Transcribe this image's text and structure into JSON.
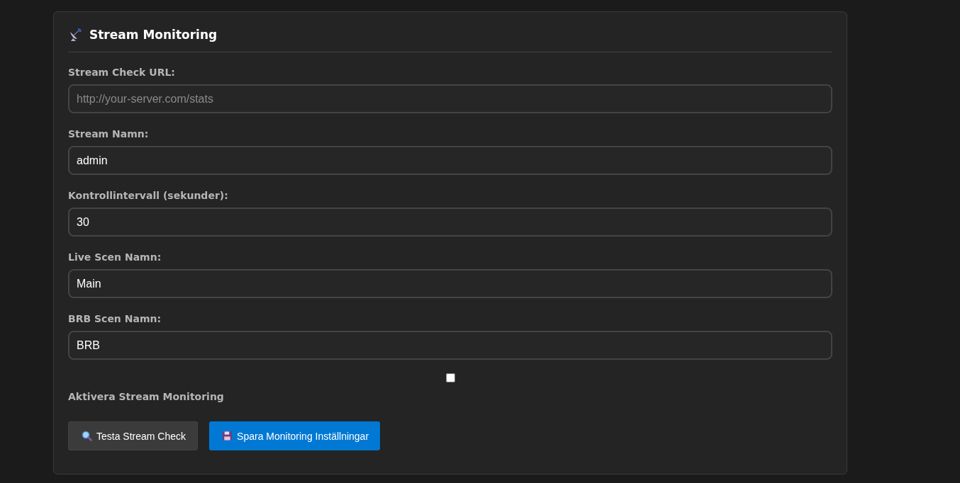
{
  "panel": {
    "title": "Stream Monitoring"
  },
  "fields": [
    {
      "label": "Stream Check URL:",
      "placeholder": "http://your-server.com/stats"
    },
    {
      "label": "Stream Namn:",
      "value": "admin"
    },
    {
      "label": "Kontrollintervall (sekunder):",
      "value": "30"
    },
    {
      "label": "Live Scen Namn:",
      "value": "Main"
    },
    {
      "label": "BRB Scen Namn:",
      "value": "BRB"
    }
  ],
  "toggle": {
    "label": "Aktivera Stream Monitoring",
    "checked": false
  },
  "buttons": [
    {
      "label": "Testa Stream Check",
      "kind": "secondary"
    },
    {
      "label": "Spara Monitoring Inställningar",
      "kind": "primary"
    }
  ]
}
